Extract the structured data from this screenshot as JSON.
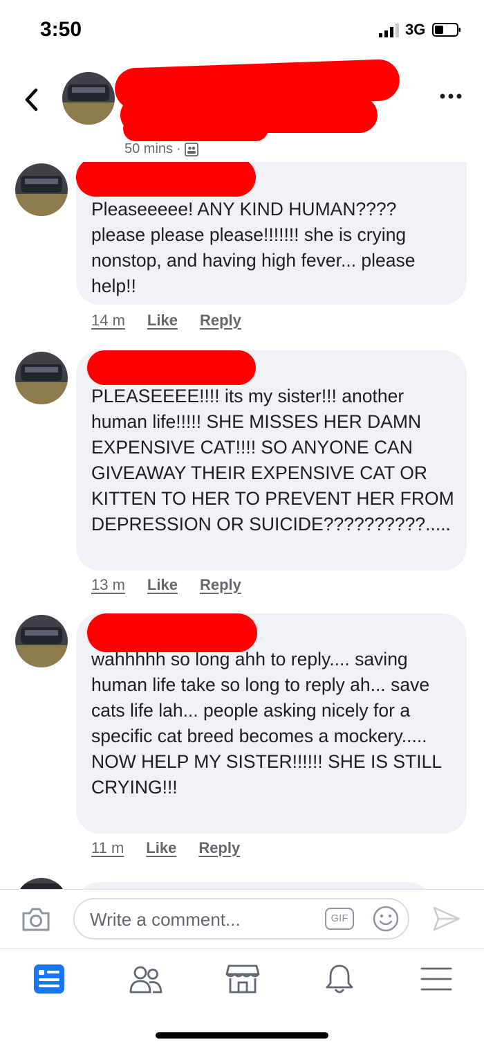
{
  "status_bar": {
    "time": "3:50",
    "network": "3G"
  },
  "header": {
    "post_time": "50 mins",
    "separator": "·"
  },
  "comments": [
    {
      "text": "Pleaseeeee! ANY KIND HUMAN???? please please please!!!!!!! she is crying nonstop, and having high fever... please help!!",
      "time": "14 m",
      "like": "Like",
      "reply": "Reply"
    },
    {
      "text": "PLEASEEEE!!!! its my sister!!! another human life!!!!! SHE MISSES HER DAMN EXPENSIVE CAT!!!! SO ANYONE CAN GIVEAWAY THEIR EXPENSIVE CAT OR KITTEN TO HER TO PREVENT HER FROM DEPRESSION OR SUICIDE??????????.....",
      "time": "13 m",
      "like": "Like",
      "reply": "Reply"
    },
    {
      "text": "wahhhhh so long ahh to reply.... saving human life take so long to reply ah... save cats life lah... people asking nicely for a specific cat breed becomes a mockery..... NOW HELP MY SISTER!!!!!! SHE IS STILL CRYING!!!",
      "time": "11 m",
      "like": "Like",
      "reply": "Reply"
    }
  ],
  "composer": {
    "placeholder": "Write a comment...",
    "gif_label": "GIF"
  },
  "tabs": [
    {
      "icon": "news-feed-icon",
      "active": true
    },
    {
      "icon": "friends-icon",
      "active": false
    },
    {
      "icon": "marketplace-icon",
      "active": false
    },
    {
      "icon": "notifications-bell-icon",
      "active": false
    },
    {
      "icon": "menu-icon",
      "active": false
    }
  ],
  "colors": {
    "accent": "#1877f2",
    "redaction": "#ff0000",
    "bubble": "#f0f1f4",
    "muted": "#65676b"
  }
}
